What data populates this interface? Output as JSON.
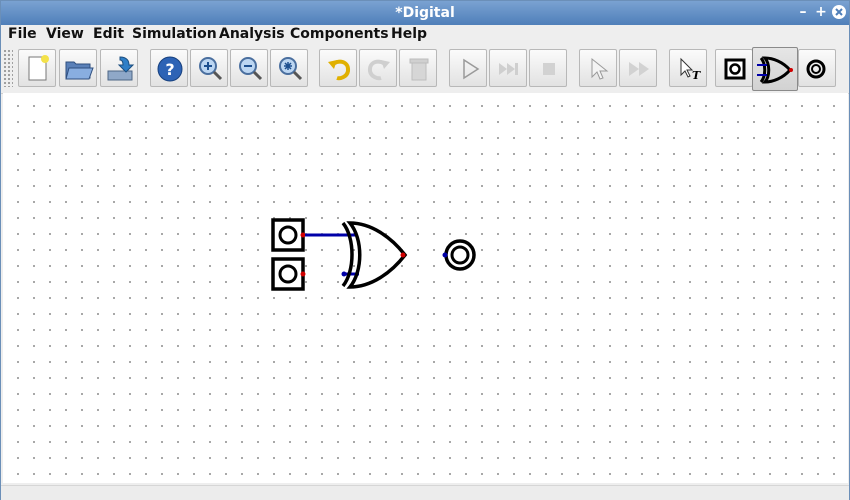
{
  "window": {
    "title": "*Digital",
    "minimize_icon": "minimize-icon",
    "maximize_icon": "maximize-icon",
    "close_icon": "close-icon"
  },
  "menu": [
    "File",
    "View",
    "Edit",
    "Simulation",
    "Analysis",
    "Components",
    "Help"
  ],
  "toolbar": {
    "buttons": [
      {
        "icon": "new-file-icon"
      },
      {
        "icon": "open-folder-icon"
      },
      {
        "icon": "save-icon"
      },
      {
        "icon": "help-icon"
      },
      {
        "icon": "zoom-in-icon"
      },
      {
        "icon": "zoom-out-icon"
      },
      {
        "icon": "zoom-fit-icon"
      },
      {
        "icon": "undo-icon"
      },
      {
        "icon": "redo-icon"
      },
      {
        "icon": "delete-icon"
      },
      {
        "icon": "run-icon"
      },
      {
        "icon": "step-icon"
      },
      {
        "icon": "stop-icon"
      },
      {
        "icon": "analyze-icon"
      },
      {
        "icon": "fast-forward-icon"
      },
      {
        "icon": "text-cursor-icon"
      },
      {
        "icon": "input-component-icon"
      },
      {
        "icon": "xor-gate-icon"
      },
      {
        "icon": "output-component-icon"
      }
    ]
  },
  "colors": {
    "wire": "#0000a8",
    "pin": "#d00000",
    "title_bar": "#5b89c2",
    "component": "#000000"
  },
  "circuit": {
    "components": [
      "input-a",
      "input-b",
      "xor-gate",
      "output-led"
    ]
  }
}
